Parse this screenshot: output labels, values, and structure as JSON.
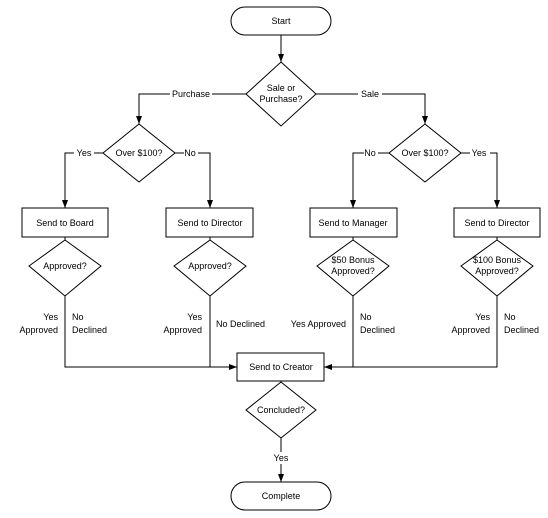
{
  "nodes": {
    "start": "Start",
    "sale_or_purchase": [
      "Sale or",
      "Purchase?"
    ],
    "over_left": "Over $100?",
    "over_right": "Over $100?",
    "board": "Send to Board",
    "director_left": "Send to Director",
    "manager": "Send to Manager",
    "director_right": "Send to Director",
    "approved_1": "Approved?",
    "approved_2": "Approved?",
    "bonus50": [
      "$50 Bonus",
      "Approved?"
    ],
    "bonus100": [
      "$100 Bonus",
      "Approved?"
    ],
    "creator": "Send to Creator",
    "concluded": "Concluded?",
    "complete": "Complete"
  },
  "edges": {
    "purchase": "Purchase",
    "sale": "Sale",
    "yes": "Yes",
    "no": "No",
    "approved": "Approved",
    "declined": "Declined",
    "no_declined": "No Declined",
    "yes_approved": "Yes Approved"
  }
}
